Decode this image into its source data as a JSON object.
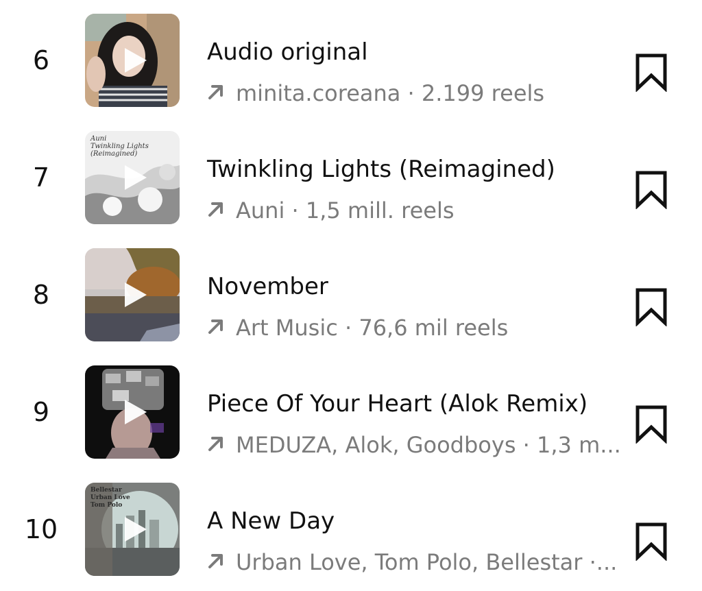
{
  "items": [
    {
      "rank": "6",
      "title": "Audio original",
      "subtitle": "minita.coreana · 2.199 reels",
      "thumbnail_text": "",
      "thumbnail": "selfie-photo",
      "play_icon": "play-icon",
      "arrow_icon": "trending-arrow-icon",
      "save_icon": "bookmark-icon"
    },
    {
      "rank": "7",
      "title": "Twinkling Lights (Reimagined)",
      "subtitle": "Auni · 1,5 mill. reels",
      "thumbnail_text": "Auni\nTwinkling Lights (Reimagined)",
      "thumbnail": "snowy-trees-cover",
      "play_icon": "play-icon",
      "arrow_icon": "trending-arrow-icon",
      "save_icon": "bookmark-icon"
    },
    {
      "rank": "8",
      "title": "November",
      "subtitle": "Art Music · 76,6 mil reels",
      "thumbnail_text": "",
      "thumbnail": "autumn-lake-cover",
      "play_icon": "play-icon",
      "arrow_icon": "trending-arrow-icon",
      "save_icon": "bookmark-icon"
    },
    {
      "rank": "9",
      "title": "Piece Of Your Heart (Alok Remix)",
      "subtitle": "MEDUZA, Alok, Goodboys · 1,3 m...",
      "thumbnail_text": "",
      "thumbnail": "cameras-head-cover",
      "play_icon": "play-icon",
      "arrow_icon": "trending-arrow-icon",
      "save_icon": "bookmark-icon"
    },
    {
      "rank": "10",
      "title": "A New Day",
      "subtitle": "Urban Love, Tom Polo, Bellestar ·...",
      "thumbnail_text": "Bellestar\nUrban Love\nTom Polo",
      "thumbnail": "city-arch-cover",
      "play_icon": "play-icon",
      "arrow_icon": "trending-arrow-icon",
      "save_icon": "bookmark-icon"
    }
  ],
  "colors": {
    "text_primary": "#111111",
    "text_secondary": "#7b7b7b",
    "background": "#ffffff"
  }
}
